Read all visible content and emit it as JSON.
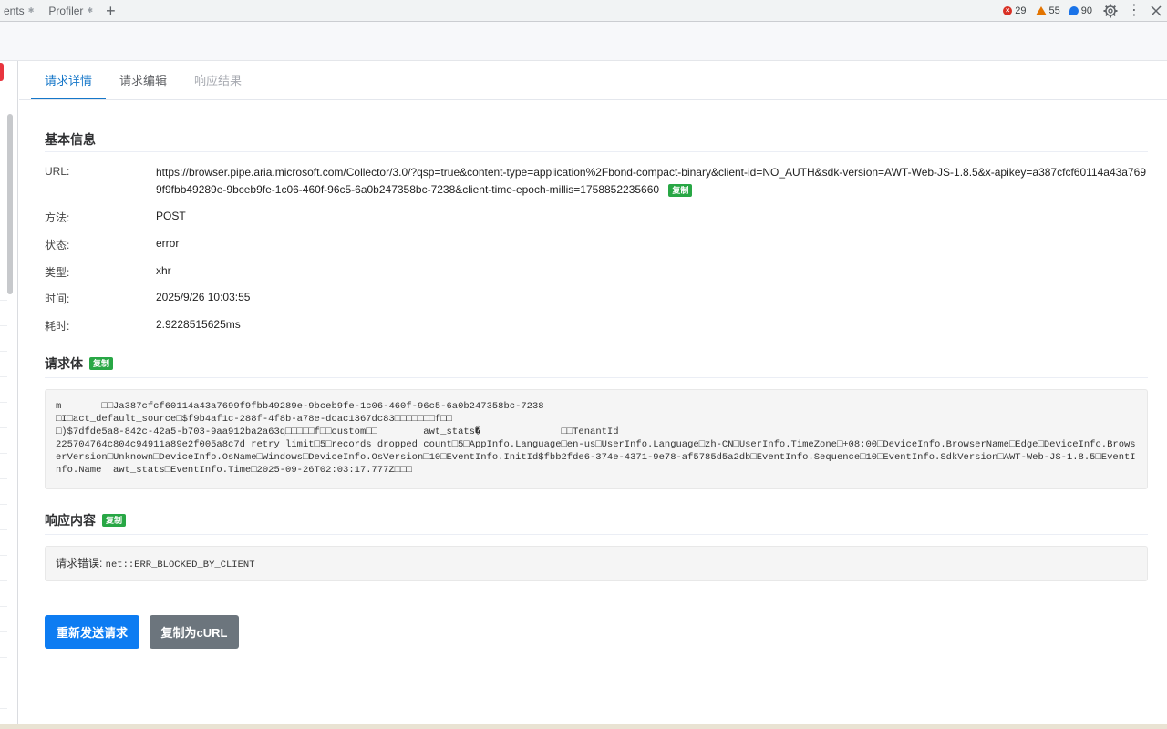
{
  "topbar": {
    "tabs": [
      {
        "label": "ents"
      },
      {
        "label": "Profiler"
      }
    ],
    "add_tab_symbol": "+",
    "counters": {
      "errors": "29",
      "warnings": "55",
      "info": "90"
    },
    "kebab_symbol": "⋮"
  },
  "subtabs": [
    {
      "label": "请求详情",
      "state": "active"
    },
    {
      "label": "请求编辑",
      "state": "normal"
    },
    {
      "label": "响应结果",
      "state": "disabled"
    }
  ],
  "basic_info": {
    "title": "基本信息",
    "copy_label": "复制",
    "url_label": "URL:",
    "url_value": "https://browser.pipe.aria.microsoft.com/Collector/3.0/?qsp=true&content-type=application%2Fbond-compact-binary&client-id=NO_AUTH&sdk-version=AWT-Web-JS-1.8.5&x-apikey=a387cfcf60114a43a7699f9fbb49289e-9bceb9fe-1c06-460f-96c5-6a0b247358bc-7238&client-time-epoch-millis=1758852235660",
    "rows": [
      {
        "label": "方法:",
        "value": "POST"
      },
      {
        "label": "状态:",
        "value": "error"
      },
      {
        "label": "类型:",
        "value": "xhr"
      },
      {
        "label": "时间:",
        "value": "2025/9/26 10:03:55"
      },
      {
        "label": "耗时:",
        "value": "2.9228515625ms"
      }
    ]
  },
  "request_body": {
    "title": "请求体",
    "copy_label": "复制",
    "content": "m       □□Ja387cfcf60114a43a7699f9fbb49289e-9bceb9fe-1c06-460f-96c5-6a0b247358bc-7238\n□I□act_default_source□$f9b4af1c-288f-4f8b-a78e-dcac1367dc83□□□□□□□f□□\n□)$7dfde5a8-842c-42a5-b703-9aa912ba2a63q□□□□□f□□custom□□        awt_stats�              □□TenantId\n225704764c804c94911a89e2f005a8c7d_retry_limit□5□records_dropped_count□5□AppInfo.Language□en-us□UserInfo.Language□zh-CN□UserInfo.TimeZone□+08:00□DeviceInfo.BrowserName□Edge□DeviceInfo.BrowserVersion□Unknown□DeviceInfo.OsName□Windows□DeviceInfo.OsVersion□10□EventInfo.InitId$fbb2fde6-374e-4371-9e78-af5785d5a2db□EventInfo.Sequence□10□EventInfo.SdkVersion□AWT-Web-JS-1.8.5□EventInfo.Name  awt_stats□EventInfo.Time□2025-09-26T02:03:17.777Z□□□"
  },
  "response": {
    "title": "响应内容",
    "copy_label": "复制",
    "prefix": "请求错误: ",
    "content": "net::ERR_BLOCKED_BY_CLIENT"
  },
  "actions": {
    "resend_label": "重新发送请求",
    "copy_curl_label": "复制为cURL"
  },
  "colors": {
    "accent": "#1677c9",
    "primary_button": "#0d7cf2",
    "secondary_button": "#6c757d",
    "copy_badge": "#28a745",
    "error": "#d93025",
    "warning": "#e37400",
    "info": "#1a73e8"
  }
}
